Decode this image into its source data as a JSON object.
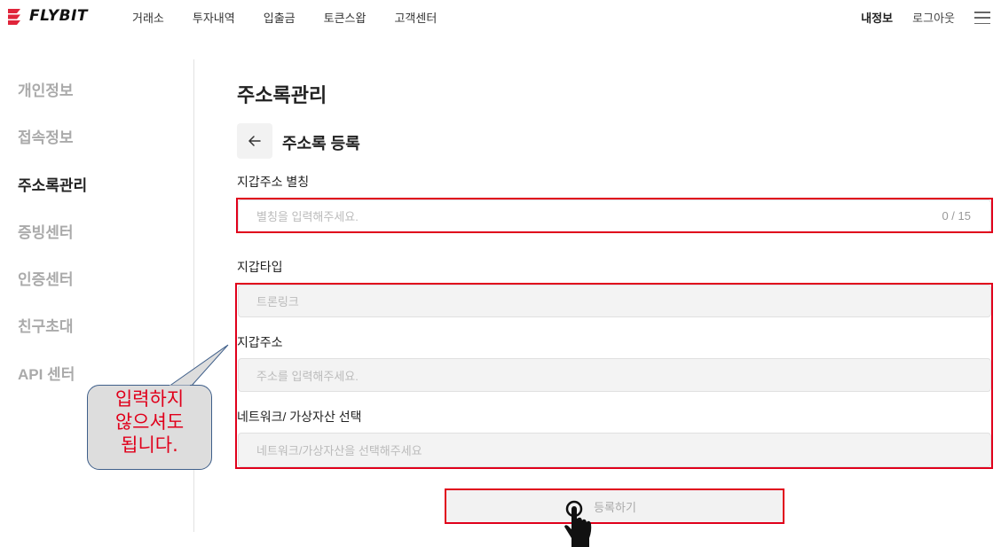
{
  "header": {
    "brand": "FLYBIT",
    "nav": [
      "거래소",
      "투자내역",
      "입출금",
      "토큰스왑",
      "고객센터"
    ],
    "my_info": "내정보",
    "logout": "로그아웃"
  },
  "sidebar": {
    "items": [
      {
        "label": "개인정보",
        "active": false
      },
      {
        "label": "접속정보",
        "active": false
      },
      {
        "label": "주소록관리",
        "active": true
      },
      {
        "label": "증빙센터",
        "active": false
      },
      {
        "label": "인증센터",
        "active": false
      },
      {
        "label": "친구초대",
        "active": false
      },
      {
        "label": "API 센터",
        "active": false
      }
    ]
  },
  "main": {
    "title": "주소록관리",
    "subtitle": "주소록 등록",
    "alias_label": "지갑주소 별칭",
    "alias_placeholder": "별칭을 입력해주세요.",
    "alias_counter": "0 / 15",
    "wallet_type_label": "지갑타입",
    "wallet_type_value": "트론링크",
    "address_label": "지갑주소",
    "address_placeholder": "주소를 입력해주세요.",
    "network_label": "네트워크/ 가상자산 선택",
    "network_placeholder": "네트워크/가상자산을 선택해주세요",
    "submit_label": "등록하기"
  },
  "annotation": {
    "callout_text_line1": "입력하지",
    "callout_text_line2": "않으셔도",
    "callout_text_line3": "됩니다.",
    "highlight_color": "#e0001b"
  }
}
